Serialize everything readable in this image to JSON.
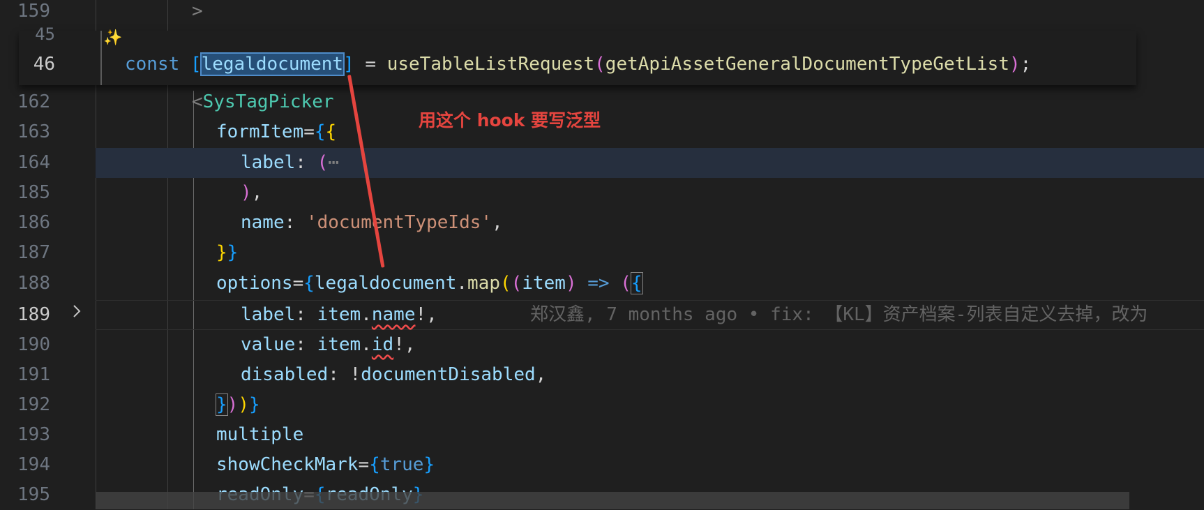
{
  "line_numbers": {
    "l159": "159",
    "l162": "162",
    "l163": "163",
    "l164": "164",
    "l185": "185",
    "l186": "186",
    "l187": "187",
    "l188": "188",
    "l189": "189",
    "l190": "190",
    "l191": "191",
    "l192": "192",
    "l193": "193",
    "l194": "194",
    "l195": "195"
  },
  "code": {
    "l159": ">",
    "l162_lt": "<",
    "l162_tag": "SysTagPicker",
    "l163_prop": "formItem",
    "l163_eq": "=",
    "l164_key": "label",
    "l164_rest": ": (",
    "l164_fold": "⋯",
    "l185_paren": ")",
    "l185_comma": ",",
    "l186_key": "name",
    "l186_colon": ": ",
    "l186_str": "'documentTypeIds'",
    "l186_comma": ",",
    "l188_prop": "options",
    "l188_eq": "=",
    "l188_var": "legaldocument",
    "l188_dot": ".",
    "l188_fn": "map",
    "l188_param": "item",
    "l188_arrow": "=>",
    "l189_key": "label",
    "l189_colon": ": ",
    "l189_obj": "item",
    "l189_dot": ".",
    "l189_prop": "name",
    "l189_rest": "!,",
    "l190_key": "value",
    "l190_colon": ": ",
    "l190_obj": "item",
    "l190_dot": ".",
    "l190_prop": "id",
    "l190_rest": "!,",
    "l191_key": "disabled",
    "l191_colon": ": !",
    "l191_var": "documentDisabled",
    "l191_comma": ",",
    "l193": "multiple",
    "l194_prop": "showCheckMark",
    "l194_eq": "=",
    "l194_val": "true",
    "l195_prop": "readOnly",
    "l195_eq": "=",
    "l195_val": "readOnly"
  },
  "blame": "郑汉鑫, 7 months ago • fix: 【KL】资产档案-列表自定义去掉，改为",
  "sticky": {
    "ln_prev": "45",
    "ln": "46",
    "kw": "const",
    "var": "legaldocument",
    "eq": " = ",
    "fn": "useTableListRequest",
    "arg": "getApiAssetGeneralDocumentTypeGetList",
    "end": ";"
  },
  "annotation": "用这个 hook 要写泛型",
  "colors": {
    "annotation": "#e5453f",
    "selection": "#264f78",
    "background": "#1f1f1f"
  },
  "icons": {
    "fold": "chevron-right-icon",
    "ai": "sparkle-icon"
  }
}
